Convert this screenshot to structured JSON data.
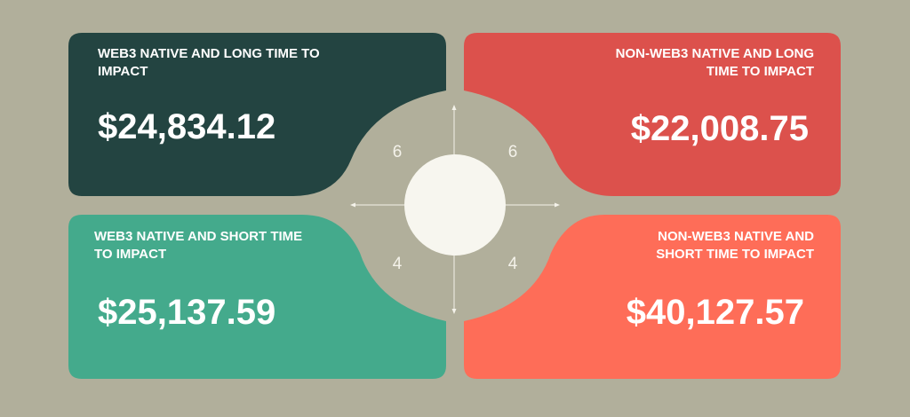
{
  "quadrants": {
    "top_left": {
      "label": "WEB3 NATIVE AND LONG TIME TO IMPACT",
      "value": "$24,834.12",
      "color": "#234441"
    },
    "top_right": {
      "label": "NON-WEB3 NATIVE AND LONG TIME TO IMPACT",
      "value": "$22,008.75",
      "color": "#dc514c"
    },
    "bottom_left": {
      "label": "WEB3 NATIVE AND SHORT TIME TO IMPACT",
      "value": "$25,137.59",
      "color": "#44aa8c"
    },
    "bottom_right": {
      "label": "NON-WEB3 NATIVE AND SHORT TIME TO IMPACT",
      "value": "$40,127.57",
      "color": "#fe6d58"
    }
  },
  "counts": {
    "top_left": "6",
    "top_right": "6",
    "bottom_left": "4",
    "bottom_right": "4"
  },
  "colors": {
    "background": "#b1af9b",
    "center_circle": "#f7f6ef",
    "axis": "#f4f2ea"
  }
}
